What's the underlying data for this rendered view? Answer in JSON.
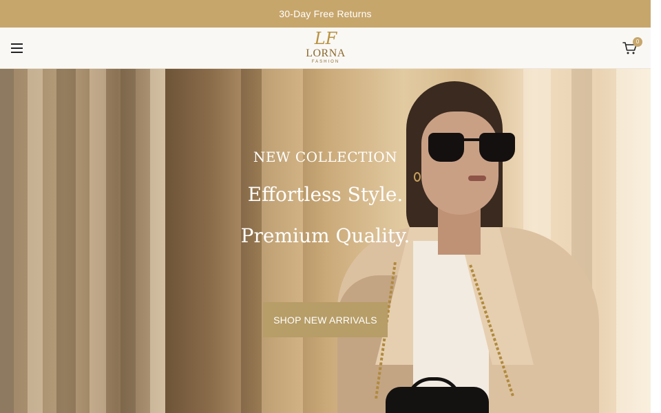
{
  "announcement": {
    "text": "30-Day Free Returns"
  },
  "header": {
    "logo_mark": "LF",
    "logo_name": "LORNA",
    "logo_sub": "FASHION",
    "cart_count": "0"
  },
  "hero": {
    "eyebrow": "NEW COLLECTION",
    "headline_line1": "Effortless Style.",
    "headline_line2": "Premium Quality.",
    "cta_label": "SHOP NEW ARRIVALS"
  },
  "colors": {
    "accent": "#c7a66c",
    "cta_background": "#b79d67",
    "header_background": "#faf8f5"
  },
  "icons": [
    "hamburger-menu-icon",
    "cart-icon"
  ]
}
